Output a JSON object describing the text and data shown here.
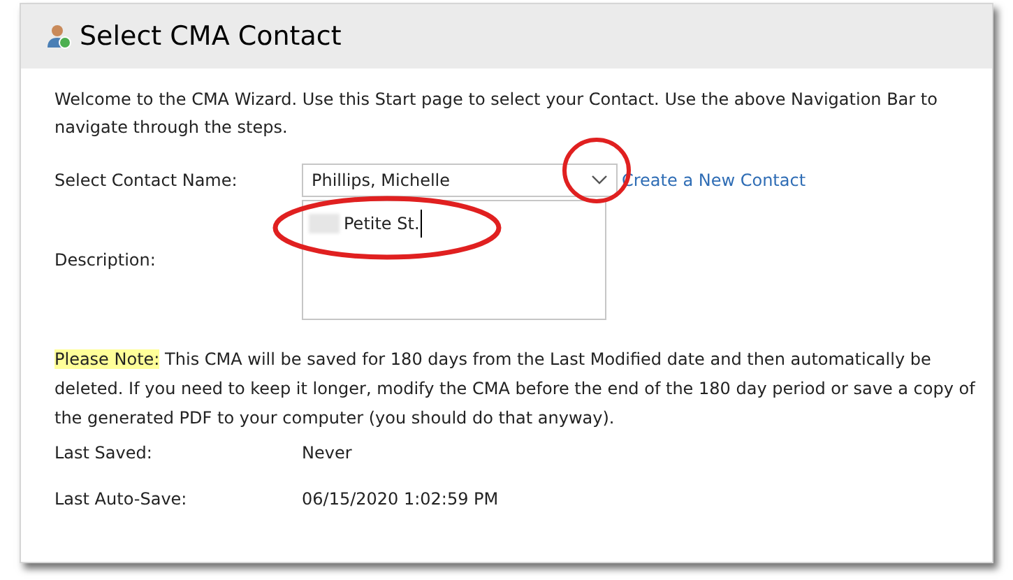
{
  "panel": {
    "title": "Select CMA Contact"
  },
  "intro": "Welcome to the CMA Wizard. Use this Start page to select your Contact. Use the above Navigation Bar to navigate through the steps.",
  "contact": {
    "label": "Select Contact Name:",
    "value": "Phillips, Michelle",
    "link": "Create a New Contact"
  },
  "description": {
    "label": "Description:",
    "value": "Petite St."
  },
  "note": {
    "label": "Please Note:",
    "text": "This CMA will be saved for 180 days from the Last Modified date and then automatically be deleted. If you need to keep it longer, modify the CMA before the end of the 180 day period or save a copy of the generated PDF to your computer (you should do that anyway)."
  },
  "info": [
    {
      "label": "Last Saved:",
      "value": "Never"
    },
    {
      "label": "Last Auto-Save:",
      "value": "06/15/2020 1:02:59 PM"
    }
  ]
}
